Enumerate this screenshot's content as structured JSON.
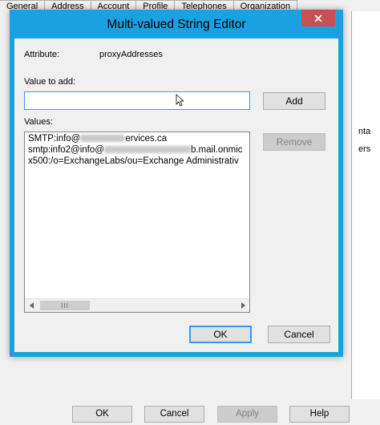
{
  "background_window": {
    "tabs": [
      "General",
      "Address",
      "Account",
      "Profile",
      "Telephones",
      "Organization"
    ],
    "side_text": [
      "nta",
      "ers"
    ],
    "buttons": {
      "ok": "OK",
      "cancel": "Cancel",
      "apply": "Apply",
      "help": "Help"
    }
  },
  "dialog": {
    "title": "Multi-valued String Editor",
    "attribute_label": "Attribute:",
    "attribute_value": "proxyAddresses",
    "value_to_add_label": "Value to add:",
    "value_input": "",
    "add_button": "Add",
    "values_label": "Values:",
    "remove_button": "Remove",
    "values": [
      {
        "prefix": "SMTP:info@",
        "suffix": "ervices.ca"
      },
      {
        "prefix": "smtp:info2@info@",
        "suffix": "b.mail.onmic"
      },
      {
        "prefix": "x500:/o=ExchangeLabs/ou=Exchange Administrativ",
        "suffix": ""
      }
    ],
    "scroll_thumb_grip": "III",
    "ok_button": "OK",
    "cancel_button": "Cancel"
  },
  "colors": {
    "title_bar": "#1ba1e2",
    "close_button": "#c75050",
    "focus_border": "#3399ff"
  }
}
